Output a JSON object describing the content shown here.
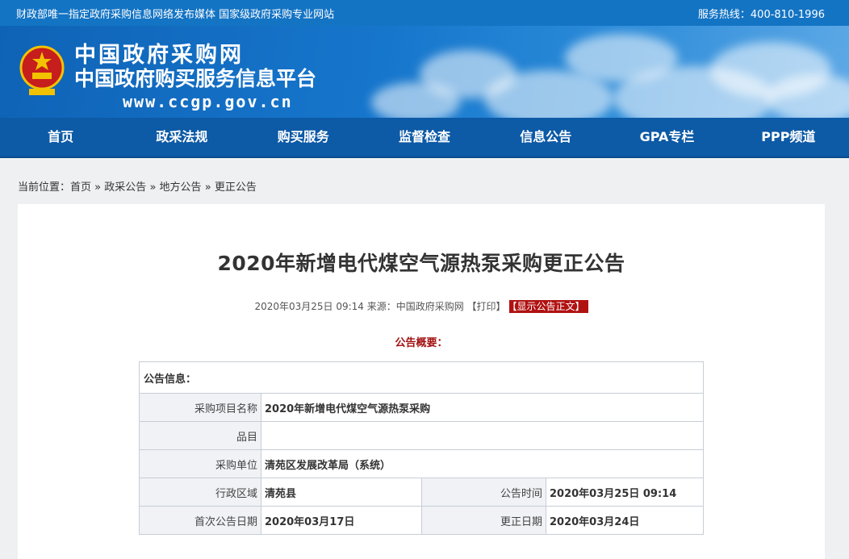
{
  "topbar": {
    "left_text": "财政部唯一指定政府采购信息网络发布媒体 国家级政府采购专业网站",
    "hotline": "服务热线：400-810-1996"
  },
  "banner": {
    "logo_line1": "中国政府采购网",
    "logo_line2": "中国政府购买服务信息平台",
    "logo_url": "www.ccgp.gov.cn"
  },
  "nav": [
    "首页",
    "政采法规",
    "购买服务",
    "监督检查",
    "信息公告",
    "GPA专栏",
    "PPP频道"
  ],
  "breadcrumb": {
    "prefix": "当前位置：",
    "items": [
      "首页",
      "政采公告",
      "地方公告",
      "更正公告"
    ],
    "sep": "»"
  },
  "article": {
    "title": "2020年新增电代煤空气源热泵采购更正公告",
    "meta": "2020年03月25日 09:14 来源：中国政府采购网 【打印】",
    "show_button": "【显示公告正文】",
    "overview": "公告概要："
  },
  "table": {
    "header": "公告信息：",
    "project_name_label": "采购项目名称",
    "project_name": "2020年新增电代煤空气源热泵采购",
    "item_label": "品目",
    "item": "",
    "buyer_label": "采购单位",
    "buyer": "清苑区发展改革局（系统）",
    "region_label": "行政区域",
    "region": "清苑县",
    "announce_time_label": "公告时间",
    "announce_time": "2020年03月25日 09:14",
    "first_date_label": "首次公告日期",
    "first_date": "2020年03月17日",
    "correction_date_label": "更正日期",
    "correction_date": "2020年03月24日"
  }
}
